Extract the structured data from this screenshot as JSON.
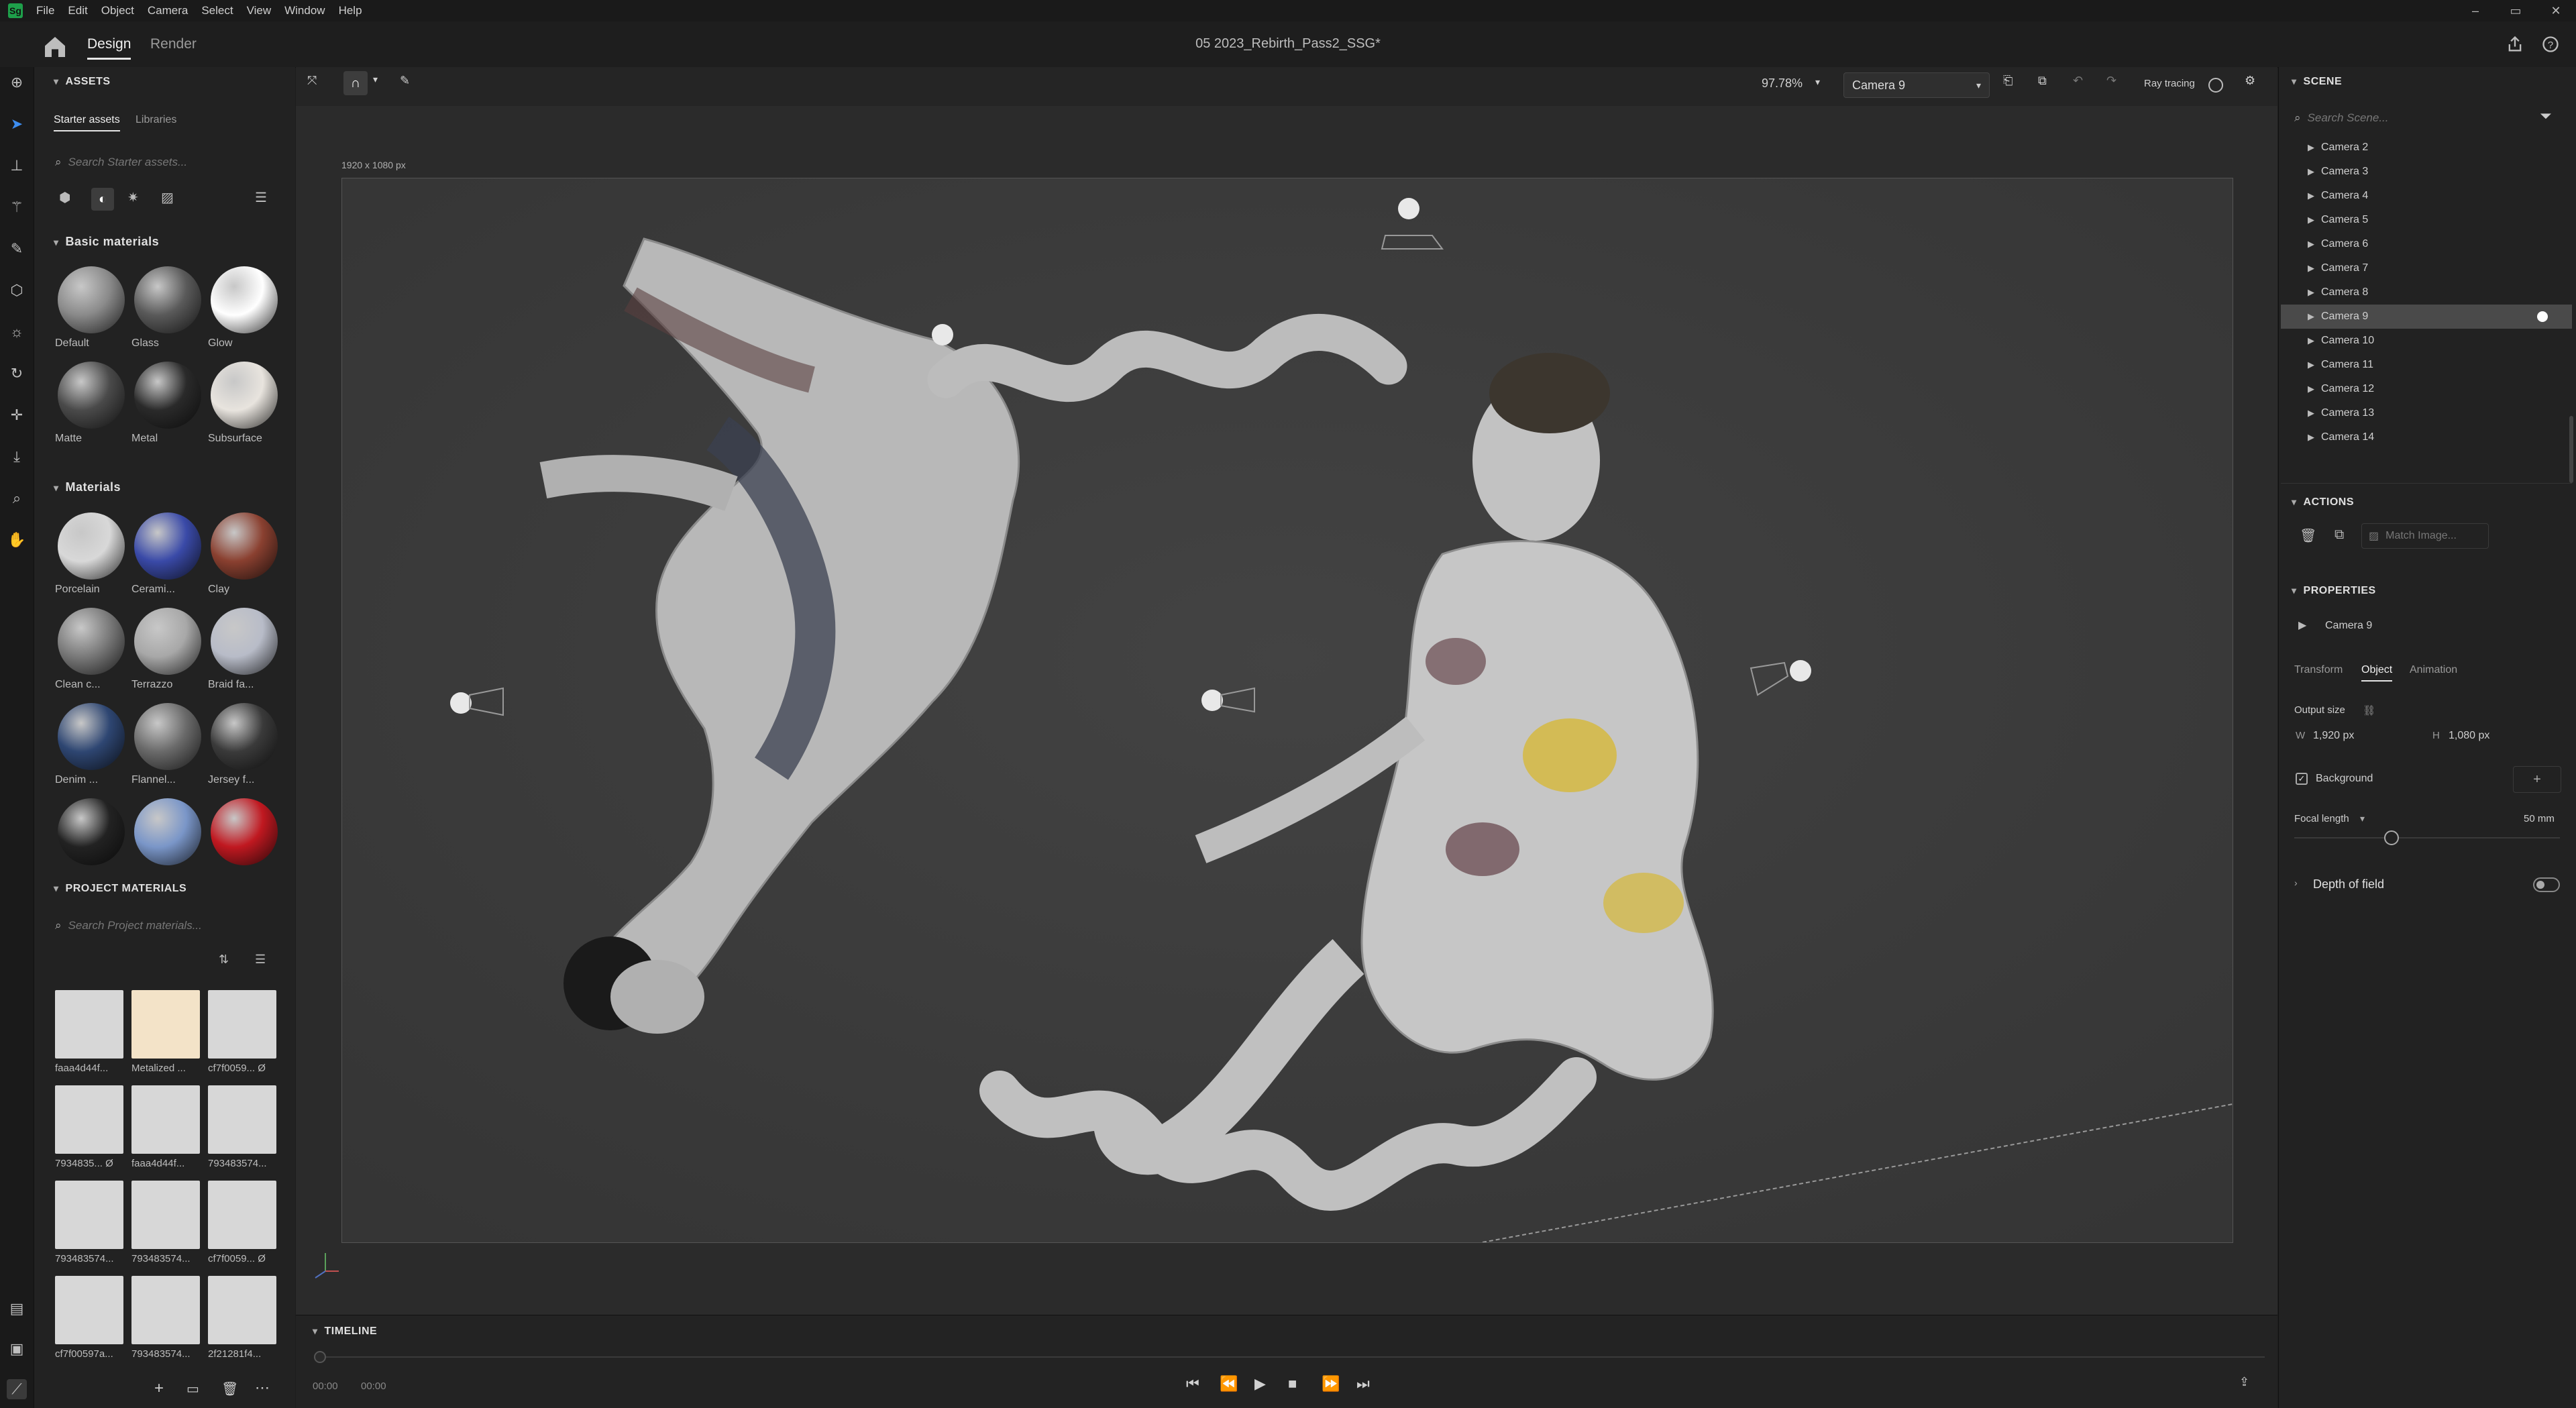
{
  "app": {
    "logo": "Sg",
    "title": "05 2023_Rebirth_Pass2_SSG*"
  },
  "menu": [
    "File",
    "Edit",
    "Object",
    "Camera",
    "Select",
    "View",
    "Window",
    "Help"
  ],
  "window_controls": [
    "–",
    "▭",
    "✕"
  ],
  "tabs": {
    "design": "Design",
    "render": "Render"
  },
  "assets": {
    "heading": "ASSETS",
    "tabs": [
      "Starter assets",
      "Libraries"
    ],
    "search_placeholder": "Search Starter assets...",
    "basic_heading": "Basic materials",
    "basic": [
      {
        "label": "Default",
        "color": "#8a8a8a"
      },
      {
        "label": "Glass",
        "color": "#5a5a5a"
      },
      {
        "label": "Glow",
        "color": "#ffffff"
      },
      {
        "label": "Matte",
        "color": "#4a4a4a"
      },
      {
        "label": "Metal",
        "color": "#2a2a2a"
      },
      {
        "label": "Subsurface",
        "color": "#e8e4de"
      }
    ],
    "materials_heading": "Materials",
    "materials": [
      {
        "label": "Porcelain",
        "color": "#d8d8d8"
      },
      {
        "label": "Cerami...",
        "color": "#3a4aa8"
      },
      {
        "label": "Clay",
        "color": "#8a4030"
      },
      {
        "label": "Clean c...",
        "color": "#7a7a7a"
      },
      {
        "label": "Terrazzo",
        "color": "#a8a8a8"
      },
      {
        "label": "Braid fa...",
        "color": "#b8bcc8"
      },
      {
        "label": "Denim ...",
        "color": "#2e4672"
      },
      {
        "label": "Flannel...",
        "color": "#6a6a6a"
      },
      {
        "label": "Jersey f...",
        "color": "#3a3a3a"
      },
      {
        "label": "",
        "color": "#222222"
      },
      {
        "label": "",
        "color": "#7a96c8"
      },
      {
        "label": "",
        "color": "#c01820"
      }
    ],
    "project_heading": "PROJECT MATERIALS",
    "project_search_placeholder": "Search Project materials...",
    "project": [
      "faaa4d44f...",
      "Metalized ...",
      "cf7f0059... Ø",
      "7934835... Ø",
      "faaa4d44f...",
      "793483574...",
      "793483574...",
      "793483574...",
      "cf7f0059... Ø",
      "cf7f00597a...",
      "793483574...",
      "2f21281f4..."
    ]
  },
  "viewport": {
    "canvas_size": "1920 x 1080 px",
    "zoom": "97.78%",
    "camera": "Camera 9",
    "ray_tracing": "Ray tracing"
  },
  "timeline": {
    "heading": "TIMELINE",
    "time_start": "00:00",
    "time_end": "00:00"
  },
  "scene": {
    "heading": "SCENE",
    "search_placeholder": "Search Scene...",
    "cameras": [
      "Camera 2",
      "Camera 3",
      "Camera 4",
      "Camera 5",
      "Camera 6",
      "Camera 7",
      "Camera 8",
      "Camera 9",
      "Camera 10",
      "Camera 11",
      "Camera 12",
      "Camera 13",
      "Camera 14"
    ],
    "selected": "Camera 9"
  },
  "actions": {
    "heading": "ACTIONS",
    "match_image": "Match Image..."
  },
  "properties": {
    "heading": "PROPERTIES",
    "object_name": "Camera 9",
    "tabs": [
      "Transform",
      "Object",
      "Animation"
    ],
    "output_size_label": "Output size",
    "width_label": "W",
    "width": "1,920 px",
    "height_label": "H",
    "height": "1,080 px",
    "background_label": "Background",
    "focal_label": "Focal length",
    "focal_value": "50 mm",
    "dof_label": "Depth of field"
  }
}
